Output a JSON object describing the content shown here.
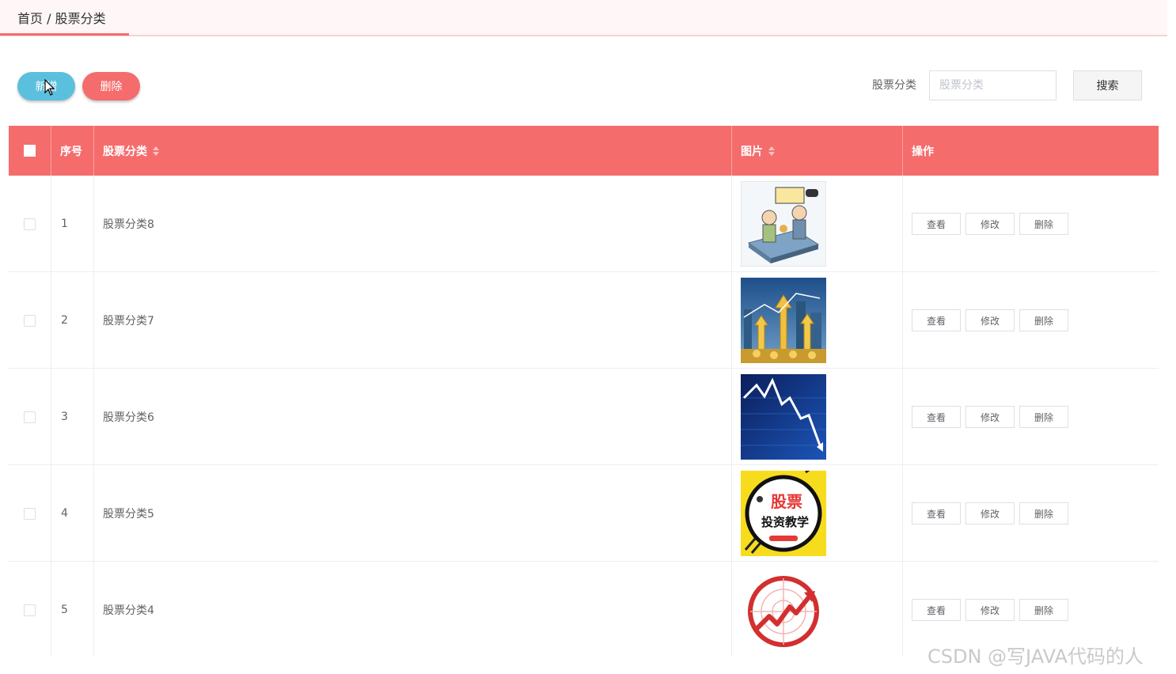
{
  "breadcrumb": {
    "text": "首页 / 股票分类"
  },
  "toolbar": {
    "add_label": "新增",
    "delete_label": "删除"
  },
  "search": {
    "label": "股票分类",
    "placeholder": "股票分类",
    "value": "",
    "button_label": "搜索"
  },
  "table": {
    "headers": {
      "index": "序号",
      "name": "股票分类",
      "image": "图片",
      "actions": "操作"
    },
    "rows": [
      {
        "index": "1",
        "name": "股票分类8",
        "image_icon": "cartoon-stock-illustration"
      },
      {
        "index": "2",
        "name": "股票分类7",
        "image_icon": "gold-arrows-city-photo"
      },
      {
        "index": "3",
        "name": "股票分类6",
        "image_icon": "blue-stock-chart-photo"
      },
      {
        "index": "4",
        "name": "股票分类5",
        "image_icon": "yellow-badge-logo",
        "image_text_1": "股票",
        "image_text_2": "投资教学"
      },
      {
        "index": "5",
        "name": "股票分类4",
        "image_icon": "red-radar-growth-logo"
      }
    ],
    "row_actions": {
      "view": "查看",
      "edit": "修改",
      "delete": "删除"
    }
  },
  "watermark": "CSDN @写JAVA代码的人",
  "colors": {
    "header": "#f56c6c",
    "add": "#5bc0de",
    "delete": "#f56c6c"
  }
}
